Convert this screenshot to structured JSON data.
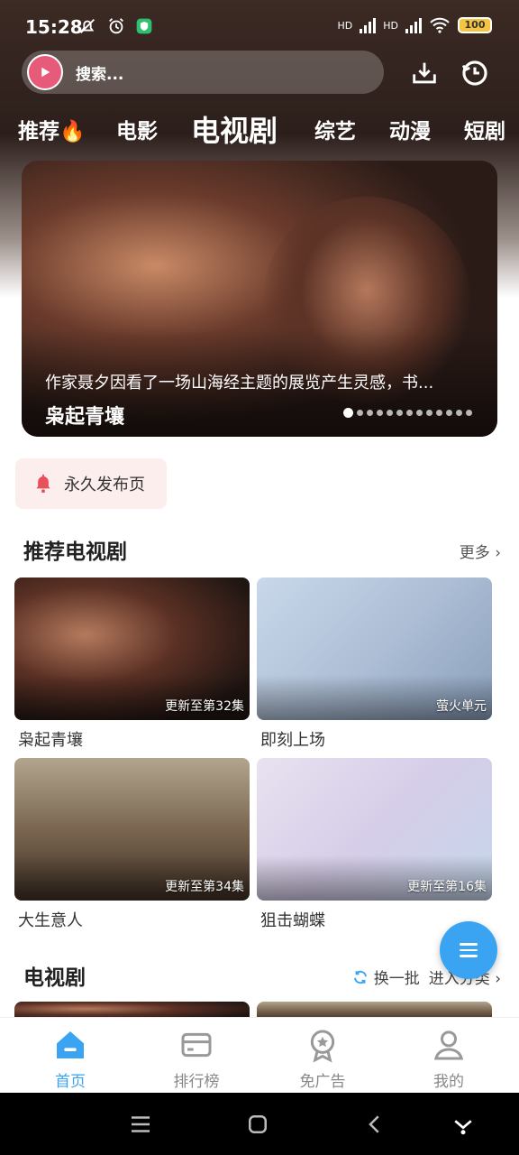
{
  "status_bar": {
    "time": "15:28",
    "battery": "100",
    "hd1": "HD",
    "hd2": "HD"
  },
  "search": {
    "placeholder": "搜索..."
  },
  "icons": {
    "download": "download-icon",
    "history": "history-icon",
    "fire": "fire-icon"
  },
  "category_tabs": [
    {
      "label": "推荐"
    },
    {
      "label": "电影"
    },
    {
      "label": "电视剧"
    },
    {
      "label": "综艺"
    },
    {
      "label": "动漫"
    },
    {
      "label": "短剧"
    }
  ],
  "banner": {
    "description": "作家聂夕因看了一场山海经主题的展览产生灵感，书...",
    "title": "枭起青壤",
    "slide_count": 13,
    "active_slide": 1
  },
  "permanent_page": {
    "label": "永久发布页"
  },
  "recommended_section": {
    "title": "推荐电视剧",
    "more": "更多",
    "cards": [
      {
        "title": "枭起青壤",
        "badge": "更新至第32集"
      },
      {
        "title": "即刻上场",
        "badge": "萤火单元"
      },
      {
        "title": "大生意人",
        "badge": "更新至第34集"
      },
      {
        "title": "狙击蝴蝶",
        "badge": "更新至第16集"
      }
    ]
  },
  "tv_section": {
    "title": "电视剧",
    "refresh": "换一批",
    "enter": "进入分类"
  },
  "bottom_nav": [
    {
      "label": "首页",
      "icon": "home-icon",
      "active": true
    },
    {
      "label": "排行榜",
      "icon": "ranking-icon",
      "active": false
    },
    {
      "label": "免广告",
      "icon": "ad-free-icon",
      "active": false
    },
    {
      "label": "我的",
      "icon": "profile-icon",
      "active": false
    }
  ],
  "colors": {
    "accent": "#3aa4f2",
    "badge_bg": "#fdeeee",
    "bell": "#e8505b"
  }
}
